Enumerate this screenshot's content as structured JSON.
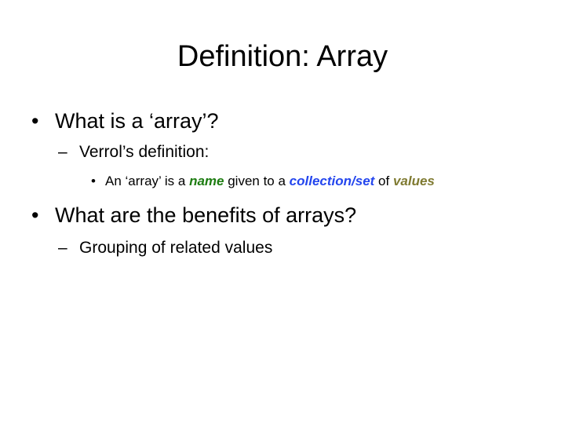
{
  "title": "Definition: Array",
  "colors": {
    "name": "#1e7d12",
    "collection": "#2446ee",
    "values": "#7f7a31"
  },
  "bullets": [
    {
      "glyph": "•",
      "text": "What is  a ‘array’?"
    },
    {
      "glyph": "–",
      "text": "Verrol’s definition:"
    },
    {
      "glyph": "•",
      "pre": "An ‘array’ is a ",
      "term1": "name",
      "mid1": " given to a ",
      "term2": "collection/set",
      "mid2": " of ",
      "term3": "values"
    },
    {
      "glyph": "•",
      "text": "What are the benefits of arrays?"
    },
    {
      "glyph": "–",
      "text": "Grouping of related values"
    }
  ]
}
